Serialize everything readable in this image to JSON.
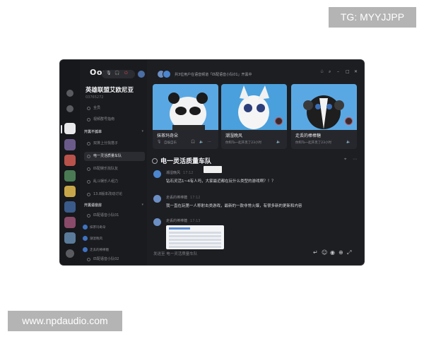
{
  "watermarks": {
    "top": "TG: MYYJJPP",
    "bottom": "www.npdaudio.com"
  },
  "app": {
    "logo": "Oopz.",
    "online_text": "共3位用户在语音频道「匹配语音小队01」开黑中",
    "server": {
      "name": "英雄联盟艾欧尼亚",
      "id": "03765272"
    },
    "top_channels": [
      {
        "label": "全员"
      },
      {
        "label": "视频群号指南"
      }
    ],
    "groups": [
      {
        "label": "开黑不孤单",
        "channels": [
          {
            "label": "双排上分找搭子",
            "active": false
          },
          {
            "label": "电一灵活质量车队",
            "active": true
          },
          {
            "label": "匹配娱乐找队友",
            "active": false
          },
          {
            "label": "乱斗娱乐人组力",
            "active": false
          },
          {
            "label": "13.8版本改动讨论",
            "active": false
          }
        ]
      },
      {
        "label": "开黑语音房",
        "channels": [
          {
            "label": "匹配语音小队01",
            "active": false
          }
        ],
        "members": [
          "抹茶玛奇朵",
          "潮湿晚风",
          "走丢的棒棒糖"
        ],
        "after": "匹配语音小队02"
      }
    ],
    "cards": [
      {
        "name": "抹茶玛奇朵",
        "sub": "自娱自乐"
      },
      {
        "name": "潮湿晚风",
        "sub": "你和Ta一起开黑了23小时"
      },
      {
        "name": "走丢的棒棒糖",
        "sub": "你和Ta一起开黑了23小时"
      }
    ],
    "chat": {
      "channel": "电一灵活质量车队",
      "messages": [
        {
          "author": "潮湿晚风",
          "time": "17:12",
          "text": "钻石灵活1~4有人吗，大家最近都在玩什么类型的游戏啊？！？"
        },
        {
          "author": "走丢的棒棒糖",
          "time": "17:12",
          "text": "我一直在玩第一人称射击类游戏，最新的一款非常火爆，有很多新的更新和内容"
        },
        {
          "author": "走丢的棒棒糖",
          "time": "17:13",
          "text": ""
        }
      ],
      "composer_placeholder": "发送至 电一灵活质量车队"
    }
  },
  "colors": {
    "bg": "#1d1e22",
    "panel": "#1a1b1f",
    "active": "#2b2c31",
    "accent": "#4b86cf",
    "mute": "#c94b4b"
  },
  "icons": [
    "headphones-icon",
    "mic-icon",
    "emoji-icon",
    "plus-icon",
    "expand-icon",
    "send-icon",
    "settings-icon"
  ]
}
